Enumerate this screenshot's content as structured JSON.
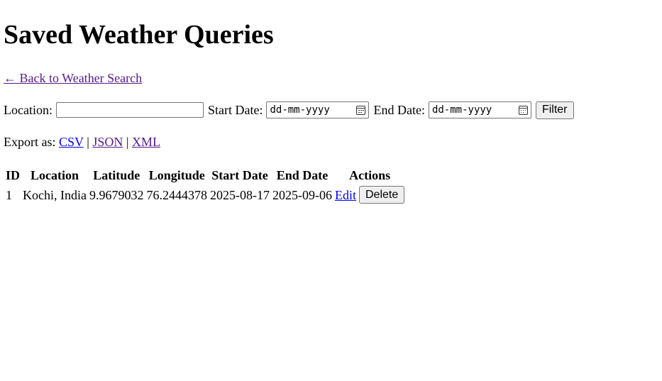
{
  "page": {
    "title": "Saved Weather Queries",
    "back_link": "← Back to Weather Search"
  },
  "filters": {
    "location_label": "Location:",
    "location_value": "",
    "start_label": "Start Date:",
    "start_placeholder": "dd-mm-yyyy",
    "end_label": "End Date:",
    "end_placeholder": "dd-mm-yyyy",
    "filter_button": "Filter"
  },
  "export": {
    "label": "Export as:",
    "csv": "CSV",
    "json": "JSON",
    "xml": "XML",
    "separator": "|"
  },
  "table": {
    "headers": [
      "ID",
      "Location",
      "Latitude",
      "Longitude",
      "Start Date",
      "End Date",
      "Actions"
    ],
    "rows": [
      {
        "id": "1",
        "location": "Kochi, India",
        "latitude": "9.9679032",
        "longitude": "76.2444378",
        "start_date": "2025-08-17",
        "end_date": "2025-09-06",
        "edit_label": "Edit",
        "delete_label": "Delete"
      }
    ]
  },
  "colors": {
    "link": "#0000ee",
    "visited_link": "#551a8b",
    "button_bg": "#efefef"
  },
  "icons": {
    "date_picker": "calendar-icon"
  }
}
